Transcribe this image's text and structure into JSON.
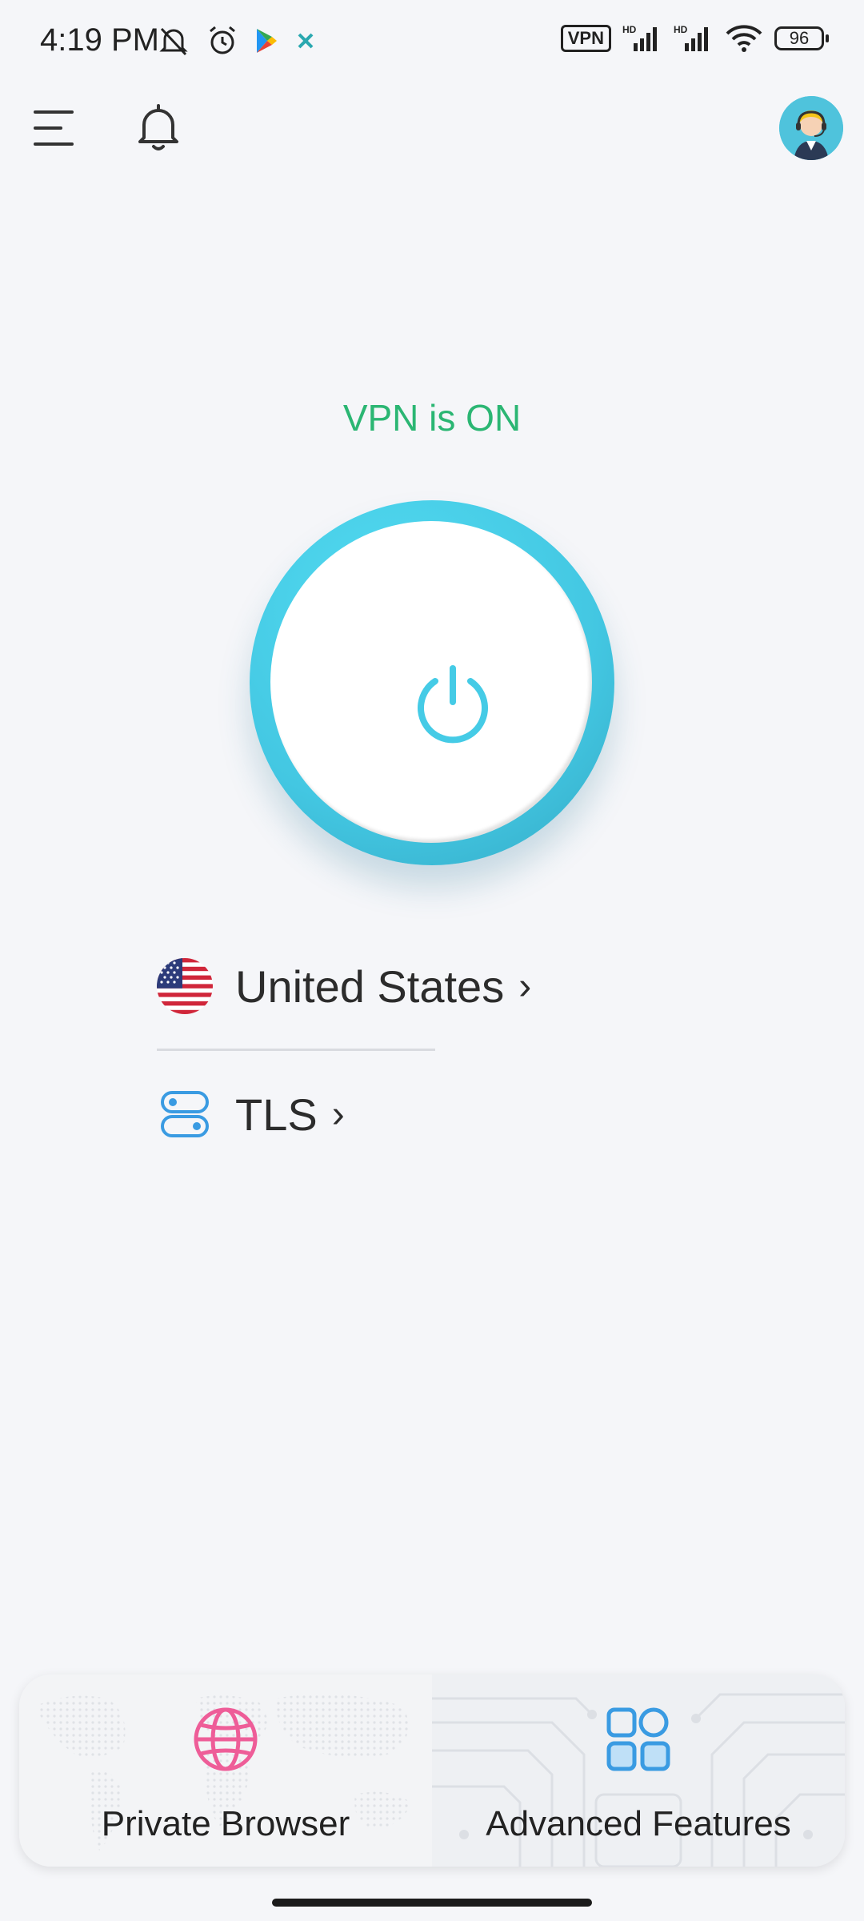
{
  "status_bar": {
    "time": "4:19 PM",
    "vpn_badge": "VPN",
    "hd_label": "HD",
    "battery": "96",
    "left_icons": [
      "bell-off-icon",
      "alarm-icon",
      "play-store-icon",
      "x-app-icon"
    ],
    "right_icons": [
      "vpn-badge",
      "signal-hd-icon",
      "signal-hd-icon",
      "wifi-icon",
      "battery-icon"
    ]
  },
  "top_bar": {
    "icons": [
      "menu-icon",
      "bell-icon",
      "support-avatar-icon"
    ]
  },
  "vpn": {
    "status_text": "VPN is ON",
    "status_color": "#2bb673",
    "accent_color": "#45cbe6"
  },
  "location": {
    "country": "United States",
    "chevron": "›"
  },
  "protocol": {
    "name": "TLS",
    "chevron": "›"
  },
  "bottom_tabs": [
    {
      "label": "Private Browser",
      "icon": "globe-icon",
      "icon_color": "#ee5d98"
    },
    {
      "label": "Advanced Features",
      "icon": "grid-icon",
      "icon_color": "#3a9be2"
    }
  ]
}
